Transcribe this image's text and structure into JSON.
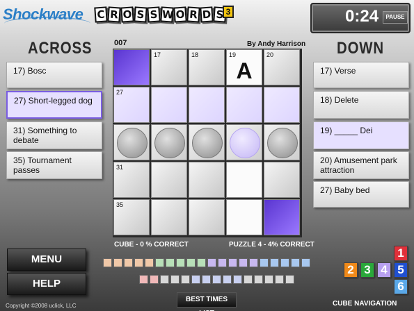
{
  "header": {
    "brand": "Shockwave",
    "game_letters": [
      "C",
      "R",
      "O",
      "S",
      "S",
      "W",
      "O",
      "R",
      "D",
      "S"
    ],
    "edition": "3",
    "timer": "0:24",
    "pause_label": "PAUSE"
  },
  "across": {
    "heading": "ACROSS",
    "clues": [
      {
        "label": "17) Bosc",
        "state": "normal"
      },
      {
        "label": "27) Short-legged dog",
        "state": "selected"
      },
      {
        "label": "31) Something to debate",
        "state": "normal"
      },
      {
        "label": "35) Tournament passes",
        "state": "normal"
      }
    ]
  },
  "down": {
    "heading": "DOWN",
    "clues": [
      {
        "label": "17) Verse",
        "state": "normal"
      },
      {
        "label": "18) Delete",
        "state": "normal"
      },
      {
        "label": "19) _____ Dei",
        "state": "highlight"
      },
      {
        "label": "20) Amusement park attraction",
        "state": "normal"
      },
      {
        "label": "27) Baby bed",
        "state": "normal"
      }
    ]
  },
  "puzzle": {
    "id": "007",
    "author": "By Andy Harrison",
    "cube_status": "CUBE - 0 % CORRECT",
    "puzzle_status": "PUZZLE 4 - 4% CORRECT",
    "cells": [
      [
        {
          "kind": "purple",
          "num": ""
        },
        {
          "kind": "gray",
          "num": "17"
        },
        {
          "kind": "gray",
          "num": "18"
        },
        {
          "kind": "white",
          "num": "19",
          "letter": "A"
        },
        {
          "kind": "gray",
          "num": "20"
        }
      ],
      [
        {
          "kind": "lav",
          "num": "27"
        },
        {
          "kind": "lav",
          "num": ""
        },
        {
          "kind": "lav",
          "num": ""
        },
        {
          "kind": "lav",
          "num": ""
        },
        {
          "kind": "lav",
          "num": ""
        }
      ],
      [
        {
          "kind": "disc",
          "num": ""
        },
        {
          "kind": "disc",
          "num": ""
        },
        {
          "kind": "disc",
          "num": ""
        },
        {
          "kind": "disc-lav",
          "num": ""
        },
        {
          "kind": "disc",
          "num": ""
        }
      ],
      [
        {
          "kind": "gray",
          "num": "31"
        },
        {
          "kind": "gray",
          "num": ""
        },
        {
          "kind": "gray",
          "num": ""
        },
        {
          "kind": "white",
          "num": ""
        },
        {
          "kind": "gray",
          "num": ""
        }
      ],
      [
        {
          "kind": "gray",
          "num": "35"
        },
        {
          "kind": "gray",
          "num": ""
        },
        {
          "kind": "gray",
          "num": ""
        },
        {
          "kind": "white",
          "num": ""
        },
        {
          "kind": "purple",
          "num": ""
        }
      ]
    ]
  },
  "progress": {
    "row1_colors": [
      "#f0c8a8",
      "#f0c8a8",
      "#f0c8a8",
      "#f0c8a8",
      "#f0c8a8",
      "#b8e0b8",
      "#b8e0b8",
      "#b8e0b8",
      "#b8e0b8",
      "#b8e0b8",
      "#c8b8f0",
      "#c8b8f0",
      "#c8b8f0",
      "#c8b8f0",
      "#c8b8f0",
      "#a8c8f0",
      "#a8c8f0",
      "#a8c8f0",
      "#a8c8f0",
      "#a8c8f0"
    ],
    "row2_colors": [
      "#f0b8b8",
      "#f0b8b8",
      "#d8d8d8",
      "#d8d8d8",
      "#d8d8d8",
      "#c8d0f0",
      "#c8d0f0",
      "#c8d0f0",
      "#c8d0f0",
      "#c8d0f0",
      "#d8d8d8",
      "#d8d8d8",
      "#d8d8d8",
      "#d8d8d8",
      "#d8d8d8"
    ]
  },
  "buttons": {
    "menu": "MENU",
    "help": "HELP",
    "best_times": "BEST TIMES LIST"
  },
  "copyright": "Copyright ©2008 uclick, LLC",
  "cube_nav": {
    "label": "CUBE NAVIGATION",
    "faces": [
      {
        "num": "1",
        "color": "#e0303a"
      },
      {
        "num": "2",
        "color": "#f08a1a"
      },
      {
        "num": "3",
        "color": "#2aa83a"
      },
      {
        "num": "4",
        "color": "#b8a0f0"
      },
      {
        "num": "5",
        "color": "#2050d0"
      },
      {
        "num": "6",
        "color": "#5aa8e8"
      }
    ]
  }
}
